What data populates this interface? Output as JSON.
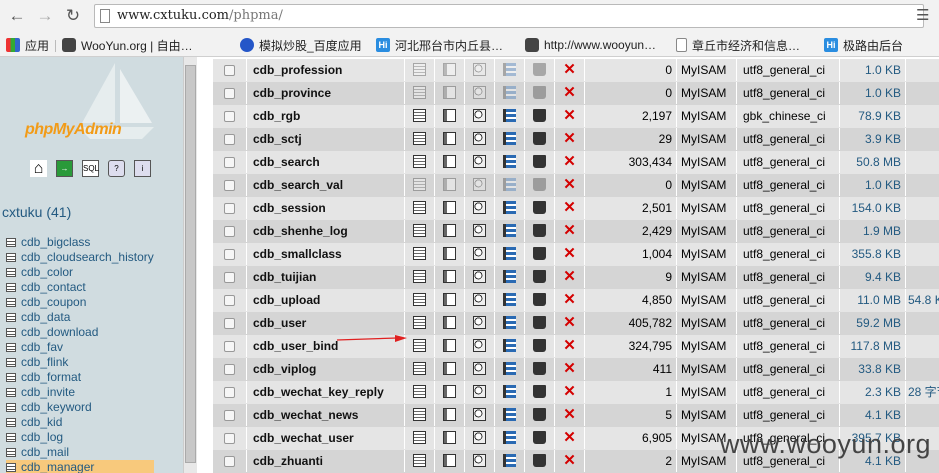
{
  "browser": {
    "url_host": "www.cxtuku.com",
    "url_path": "/phpma/",
    "bookmarks": [
      {
        "label": "应用",
        "icon": "apps-icon"
      },
      {
        "label": "WooYun.org | 自由…",
        "icon": "cloud-icon"
      },
      {
        "label": "模拟炒股_百度应用",
        "icon": "paw-icon"
      },
      {
        "label": "河北邢台市内丘县…",
        "icon": "hi-icon"
      },
      {
        "label": "http://www.wooyun…",
        "icon": "cloud-icon"
      },
      {
        "label": "章丘市经济和信息…",
        "icon": "doc-icon"
      },
      {
        "label": "极路由后台",
        "icon": "hi-icon"
      }
    ]
  },
  "sidebar": {
    "logo": "phpMyAdmin",
    "database": "cxtuku (41)",
    "tables": [
      "cdb_bigclass",
      "cdb_cloudsearch_history",
      "cdb_color",
      "cdb_contact",
      "cdb_coupon",
      "cdb_data",
      "cdb_download",
      "cdb_fav",
      "cdb_flink",
      "cdb_format",
      "cdb_invite",
      "cdb_keyword",
      "cdb_kid",
      "cdb_log",
      "cdb_mail",
      "cdb_manager"
    ],
    "active_table": "cdb_manager"
  },
  "main": {
    "rows": [
      {
        "name": "cdb_profession",
        "rows": "0",
        "type": "MyISAM",
        "collation": "utf8_general_ci",
        "size": "1.0 KB",
        "overhead": "",
        "empty": true
      },
      {
        "name": "cdb_province",
        "rows": "0",
        "type": "MyISAM",
        "collation": "utf8_general_ci",
        "size": "1.0 KB",
        "overhead": "",
        "empty": true
      },
      {
        "name": "cdb_rgb",
        "rows": "2,197",
        "type": "MyISAM",
        "collation": "gbk_chinese_ci",
        "size": "78.9 KB",
        "overhead": "",
        "empty": false
      },
      {
        "name": "cdb_sctj",
        "rows": "29",
        "type": "MyISAM",
        "collation": "utf8_general_ci",
        "size": "3.9 KB",
        "overhead": "",
        "empty": false
      },
      {
        "name": "cdb_search",
        "rows": "303,434",
        "type": "MyISAM",
        "collation": "utf8_general_ci",
        "size": "50.8 MB",
        "overhead": "",
        "empty": false
      },
      {
        "name": "cdb_search_val",
        "rows": "0",
        "type": "MyISAM",
        "collation": "utf8_general_ci",
        "size": "1.0 KB",
        "overhead": "",
        "empty": true
      },
      {
        "name": "cdb_session",
        "rows": "2,501",
        "type": "MyISAM",
        "collation": "utf8_general_ci",
        "size": "154.0 KB",
        "overhead": "",
        "empty": false
      },
      {
        "name": "cdb_shenhe_log",
        "rows": "2,429",
        "type": "MyISAM",
        "collation": "utf8_general_ci",
        "size": "1.9 MB",
        "overhead": "",
        "empty": false
      },
      {
        "name": "cdb_smallclass",
        "rows": "1,004",
        "type": "MyISAM",
        "collation": "utf8_general_ci",
        "size": "355.8 KB",
        "overhead": "",
        "empty": false
      },
      {
        "name": "cdb_tuijian",
        "rows": "9",
        "type": "MyISAM",
        "collation": "utf8_general_ci",
        "size": "9.4 KB",
        "overhead": "",
        "empty": false
      },
      {
        "name": "cdb_upload",
        "rows": "4,850",
        "type": "MyISAM",
        "collation": "utf8_general_ci",
        "size": "11.0 MB",
        "overhead": "54.8 K",
        "empty": false
      },
      {
        "name": "cdb_user",
        "rows": "405,782",
        "type": "MyISAM",
        "collation": "utf8_general_ci",
        "size": "59.2 MB",
        "overhead": "",
        "empty": false
      },
      {
        "name": "cdb_user_bind",
        "rows": "324,795",
        "type": "MyISAM",
        "collation": "utf8_general_ci",
        "size": "117.8 MB",
        "overhead": "",
        "empty": false
      },
      {
        "name": "cdb_viplog",
        "rows": "411",
        "type": "MyISAM",
        "collation": "utf8_general_ci",
        "size": "33.8 KB",
        "overhead": "",
        "empty": false
      },
      {
        "name": "cdb_wechat_key_reply",
        "rows": "1",
        "type": "MyISAM",
        "collation": "utf8_general_ci",
        "size": "2.3 KB",
        "overhead": "28 字节",
        "empty": false
      },
      {
        "name": "cdb_wechat_news",
        "rows": "5",
        "type": "MyISAM",
        "collation": "utf8_general_ci",
        "size": "4.1 KB",
        "overhead": "",
        "empty": false
      },
      {
        "name": "cdb_wechat_user",
        "rows": "6,905",
        "type": "MyISAM",
        "collation": "utf8_general_ci",
        "size": "395.7 KB",
        "overhead": "",
        "empty": false
      },
      {
        "name": "cdb_zhuanti",
        "rows": "2",
        "type": "MyISAM",
        "collation": "utf8_general_ci",
        "size": "4.1 KB",
        "overhead": "",
        "empty": false
      }
    ]
  },
  "watermark": "www.wooyun.org",
  "colors": {
    "link": "#235a81",
    "drop": "#d40000",
    "arrow": "#e02020",
    "sidebar_bg": "#d0dce0",
    "active_row": "#f8c97c"
  }
}
